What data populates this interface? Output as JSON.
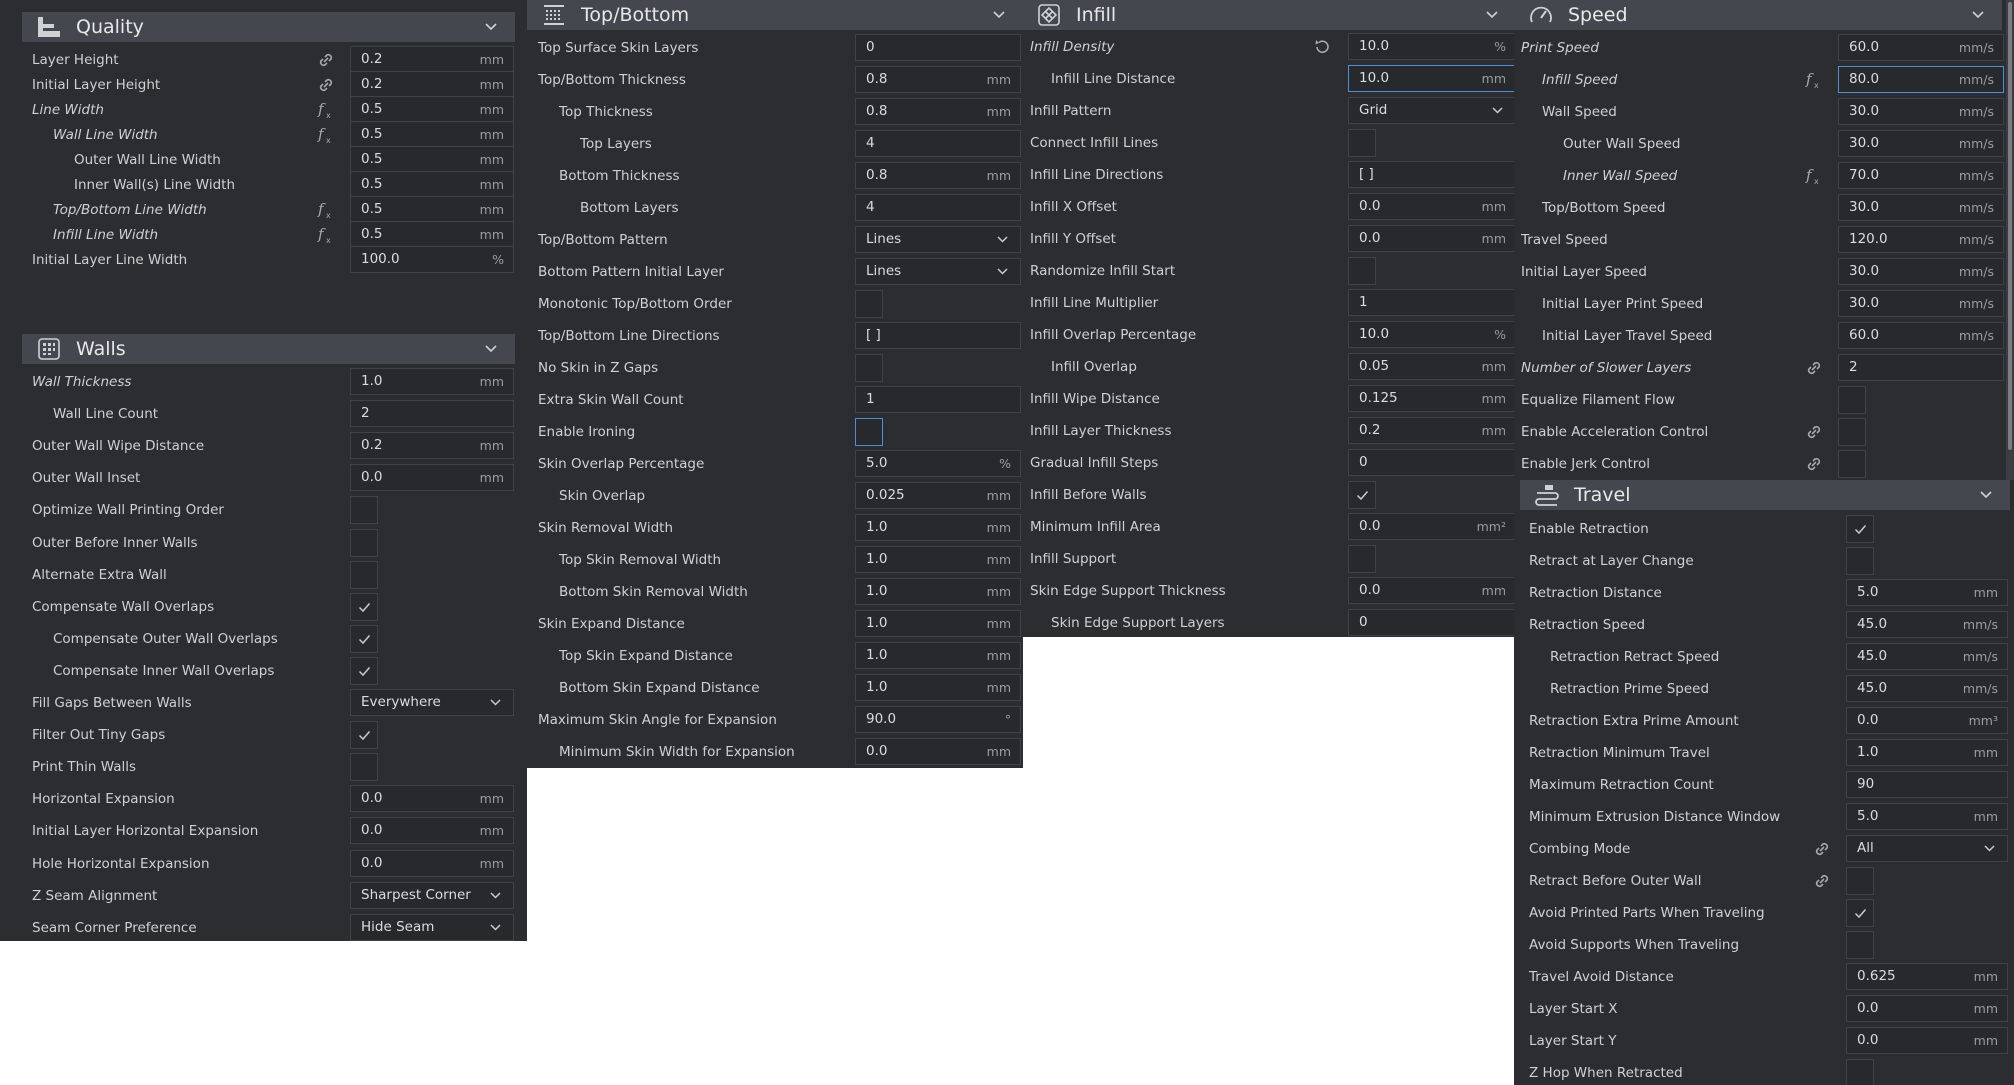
{
  "quality": {
    "title": "Quality",
    "rows": [
      {
        "label": "Layer Height",
        "value": "0.2",
        "unit": "mm",
        "icon": "link"
      },
      {
        "label": "Initial Layer Height",
        "value": "0.2",
        "unit": "mm",
        "icon": "link"
      },
      {
        "label": "Line Width",
        "value": "0.5",
        "unit": "mm",
        "icon": "fx",
        "italic": true
      },
      {
        "label": "Wall Line Width",
        "value": "0.5",
        "unit": "mm",
        "icon": "fx",
        "italic": true,
        "indent": 1
      },
      {
        "label": "Outer Wall Line Width",
        "value": "0.5",
        "unit": "mm",
        "indent": 2
      },
      {
        "label": "Inner Wall(s) Line Width",
        "value": "0.5",
        "unit": "mm",
        "indent": 2
      },
      {
        "label": "Top/Bottom Line Width",
        "value": "0.5",
        "unit": "mm",
        "icon": "fx",
        "italic": true,
        "indent": 1
      },
      {
        "label": "Infill Line Width",
        "value": "0.5",
        "unit": "mm",
        "icon": "fx",
        "italic": true,
        "indent": 1
      },
      {
        "label": "Initial Layer Line Width",
        "value": "100.0",
        "unit": "%"
      }
    ]
  },
  "walls": {
    "title": "Walls",
    "rows": [
      {
        "label": "Wall Thickness",
        "value": "1.0",
        "unit": "mm",
        "italic": true
      },
      {
        "label": "Wall Line Count",
        "value": "2",
        "indent": 1
      },
      {
        "label": "Outer Wall Wipe Distance",
        "value": "0.2",
        "unit": "mm"
      },
      {
        "label": "Outer Wall Inset",
        "value": "0.0",
        "unit": "mm"
      },
      {
        "label": "Optimize Wall Printing Order",
        "type": "check",
        "checked": false
      },
      {
        "label": "Outer Before Inner Walls",
        "type": "check",
        "checked": false
      },
      {
        "label": "Alternate Extra Wall",
        "type": "check",
        "checked": false
      },
      {
        "label": "Compensate Wall Overlaps",
        "type": "check",
        "checked": true
      },
      {
        "label": "Compensate Outer Wall Overlaps",
        "type": "check",
        "checked": true,
        "indent": 1
      },
      {
        "label": "Compensate Inner Wall Overlaps",
        "type": "check",
        "checked": true,
        "indent": 1
      },
      {
        "label": "Fill Gaps Between Walls",
        "type": "select",
        "value": "Everywhere"
      },
      {
        "label": "Filter Out Tiny Gaps",
        "type": "check",
        "checked": true
      },
      {
        "label": "Print Thin Walls",
        "type": "check",
        "checked": false
      },
      {
        "label": "Horizontal Expansion",
        "value": "0.0",
        "unit": "mm"
      },
      {
        "label": "Initial Layer Horizontal Expansion",
        "value": "0.0",
        "unit": "mm"
      },
      {
        "label": "Hole Horizontal Expansion",
        "value": "0.0",
        "unit": "mm"
      },
      {
        "label": "Z Seam Alignment",
        "type": "select",
        "value": "Sharpest Corner"
      },
      {
        "label": "Seam Corner Preference",
        "type": "select",
        "value": "Hide Seam"
      }
    ]
  },
  "topbottom": {
    "title": "Top/Bottom",
    "rows": [
      {
        "label": "Top Surface Skin Layers",
        "value": "0"
      },
      {
        "label": "Top/Bottom Thickness",
        "value": "0.8",
        "unit": "mm"
      },
      {
        "label": "Top Thickness",
        "value": "0.8",
        "unit": "mm",
        "indent": 1
      },
      {
        "label": "Top Layers",
        "value": "4",
        "indent": 2
      },
      {
        "label": "Bottom Thickness",
        "value": "0.8",
        "unit": "mm",
        "indent": 1
      },
      {
        "label": "Bottom Layers",
        "value": "4",
        "indent": 2
      },
      {
        "label": "Top/Bottom Pattern",
        "type": "select",
        "value": "Lines"
      },
      {
        "label": "Bottom Pattern Initial Layer",
        "type": "select",
        "value": "Lines"
      },
      {
        "label": "Monotonic Top/Bottom Order",
        "type": "check",
        "checked": false
      },
      {
        "label": "Top/Bottom Line Directions",
        "value": "[ ]"
      },
      {
        "label": "No Skin in Z Gaps",
        "type": "check",
        "checked": false
      },
      {
        "label": "Extra Skin Wall Count",
        "value": "1"
      },
      {
        "label": "Enable Ironing",
        "type": "check",
        "checked": false,
        "focus": true
      },
      {
        "label": "Skin Overlap Percentage",
        "value": "5.0",
        "unit": "%"
      },
      {
        "label": "Skin Overlap",
        "value": "0.025",
        "unit": "mm",
        "indent": 1
      },
      {
        "label": "Skin Removal Width",
        "value": "1.0",
        "unit": "mm"
      },
      {
        "label": "Top Skin Removal Width",
        "value": "1.0",
        "unit": "mm",
        "indent": 1
      },
      {
        "label": "Bottom Skin Removal Width",
        "value": "1.0",
        "unit": "mm",
        "indent": 1
      },
      {
        "label": "Skin Expand Distance",
        "value": "1.0",
        "unit": "mm"
      },
      {
        "label": "Top Skin Expand Distance",
        "value": "1.0",
        "unit": "mm",
        "indent": 1
      },
      {
        "label": "Bottom Skin Expand Distance",
        "value": "1.0",
        "unit": "mm",
        "indent": 1
      },
      {
        "label": "Maximum Skin Angle for Expansion",
        "value": "90.0",
        "unit": "°"
      },
      {
        "label": "Minimum Skin Width for Expansion",
        "value": "0.0",
        "unit": "mm",
        "indent": 1
      }
    ]
  },
  "infill": {
    "title": "Infill",
    "rows": [
      {
        "label": "Infill Density",
        "value": "10.0",
        "unit": "%",
        "icon": "reset",
        "italic": true
      },
      {
        "label": "Infill Line Distance",
        "value": "10.0",
        "unit": "mm",
        "indent": 1,
        "focus": true
      },
      {
        "label": "Infill Pattern",
        "type": "select",
        "value": "Grid"
      },
      {
        "label": "Connect Infill Lines",
        "type": "check",
        "checked": false
      },
      {
        "label": "Infill Line Directions",
        "value": "[ ]"
      },
      {
        "label": "Infill X Offset",
        "value": "0.0",
        "unit": "mm"
      },
      {
        "label": "Infill Y Offset",
        "value": "0.0",
        "unit": "mm"
      },
      {
        "label": "Randomize Infill Start",
        "type": "check",
        "checked": false
      },
      {
        "label": "Infill Line Multiplier",
        "value": "1"
      },
      {
        "label": "Infill Overlap Percentage",
        "value": "10.0",
        "unit": "%"
      },
      {
        "label": "Infill Overlap",
        "value": "0.05",
        "unit": "mm",
        "indent": 1
      },
      {
        "label": "Infill Wipe Distance",
        "value": "0.125",
        "unit": "mm"
      },
      {
        "label": "Infill Layer Thickness",
        "value": "0.2",
        "unit": "mm"
      },
      {
        "label": "Gradual Infill Steps",
        "value": "0"
      },
      {
        "label": "Infill Before Walls",
        "type": "check",
        "checked": true
      },
      {
        "label": "Minimum Infill Area",
        "value": "0.0",
        "unit": "mm²"
      },
      {
        "label": "Infill Support",
        "type": "check",
        "checked": false
      },
      {
        "label": "Skin Edge Support Thickness",
        "value": "0.0",
        "unit": "mm"
      },
      {
        "label": "Skin Edge Support Layers",
        "value": "0",
        "indent": 1
      }
    ]
  },
  "speed": {
    "title": "Speed",
    "rows": [
      {
        "label": "Print Speed",
        "value": "60.0",
        "unit": "mm/s",
        "italic": true
      },
      {
        "label": "Infill Speed",
        "value": "80.0",
        "unit": "mm/s",
        "icon": "fx",
        "italic": true,
        "indent": 1,
        "focus": true
      },
      {
        "label": "Wall Speed",
        "value": "30.0",
        "unit": "mm/s",
        "indent": 1
      },
      {
        "label": "Outer Wall Speed",
        "value": "30.0",
        "unit": "mm/s",
        "indent": 2
      },
      {
        "label": "Inner Wall Speed",
        "value": "70.0",
        "unit": "mm/s",
        "icon": "fx",
        "italic": true,
        "indent": 2
      },
      {
        "label": "Top/Bottom Speed",
        "value": "30.0",
        "unit": "mm/s",
        "indent": 1
      },
      {
        "label": "Travel Speed",
        "value": "120.0",
        "unit": "mm/s"
      },
      {
        "label": "Initial Layer Speed",
        "value": "30.0",
        "unit": "mm/s"
      },
      {
        "label": "Initial Layer Print Speed",
        "value": "30.0",
        "unit": "mm/s",
        "indent": 1
      },
      {
        "label": "Initial Layer Travel Speed",
        "value": "60.0",
        "unit": "mm/s",
        "indent": 1
      },
      {
        "label": "Number of Slower Layers",
        "value": "2",
        "icon": "link",
        "italic": true
      },
      {
        "label": "Equalize Filament Flow",
        "type": "check",
        "checked": false
      },
      {
        "label": "Enable Acceleration Control",
        "type": "check",
        "checked": false,
        "icon": "link"
      },
      {
        "label": "Enable Jerk Control",
        "type": "check",
        "checked": false,
        "icon": "link"
      }
    ]
  },
  "travel": {
    "title": "Travel",
    "rows": [
      {
        "label": "Enable Retraction",
        "type": "check",
        "checked": true
      },
      {
        "label": "Retract at Layer Change",
        "type": "check",
        "checked": false
      },
      {
        "label": "Retraction Distance",
        "value": "5.0",
        "unit": "mm"
      },
      {
        "label": "Retraction Speed",
        "value": "45.0",
        "unit": "mm/s"
      },
      {
        "label": "Retraction Retract Speed",
        "value": "45.0",
        "unit": "mm/s",
        "indent": 1
      },
      {
        "label": "Retraction Prime Speed",
        "value": "45.0",
        "unit": "mm/s",
        "indent": 1
      },
      {
        "label": "Retraction Extra Prime Amount",
        "value": "0.0",
        "unit": "mm³"
      },
      {
        "label": "Retraction Minimum Travel",
        "value": "1.0",
        "unit": "mm"
      },
      {
        "label": "Maximum Retraction Count",
        "value": "90"
      },
      {
        "label": "Minimum Extrusion Distance Window",
        "value": "5.0",
        "unit": "mm"
      },
      {
        "label": "Combing Mode",
        "type": "select",
        "value": "All",
        "icon": "link"
      },
      {
        "label": "Retract Before Outer Wall",
        "type": "check",
        "checked": false,
        "icon": "link"
      },
      {
        "label": "Avoid Printed Parts When Traveling",
        "type": "check",
        "checked": true
      },
      {
        "label": "Avoid Supports When Traveling",
        "type": "check",
        "checked": false
      },
      {
        "label": "Travel Avoid Distance",
        "value": "0.625",
        "unit": "mm"
      },
      {
        "label": "Layer Start X",
        "value": "0.0",
        "unit": "mm"
      },
      {
        "label": "Layer Start Y",
        "value": "0.0",
        "unit": "mm"
      },
      {
        "label": "Z Hop When Retracted",
        "type": "check",
        "checked": false
      }
    ]
  }
}
